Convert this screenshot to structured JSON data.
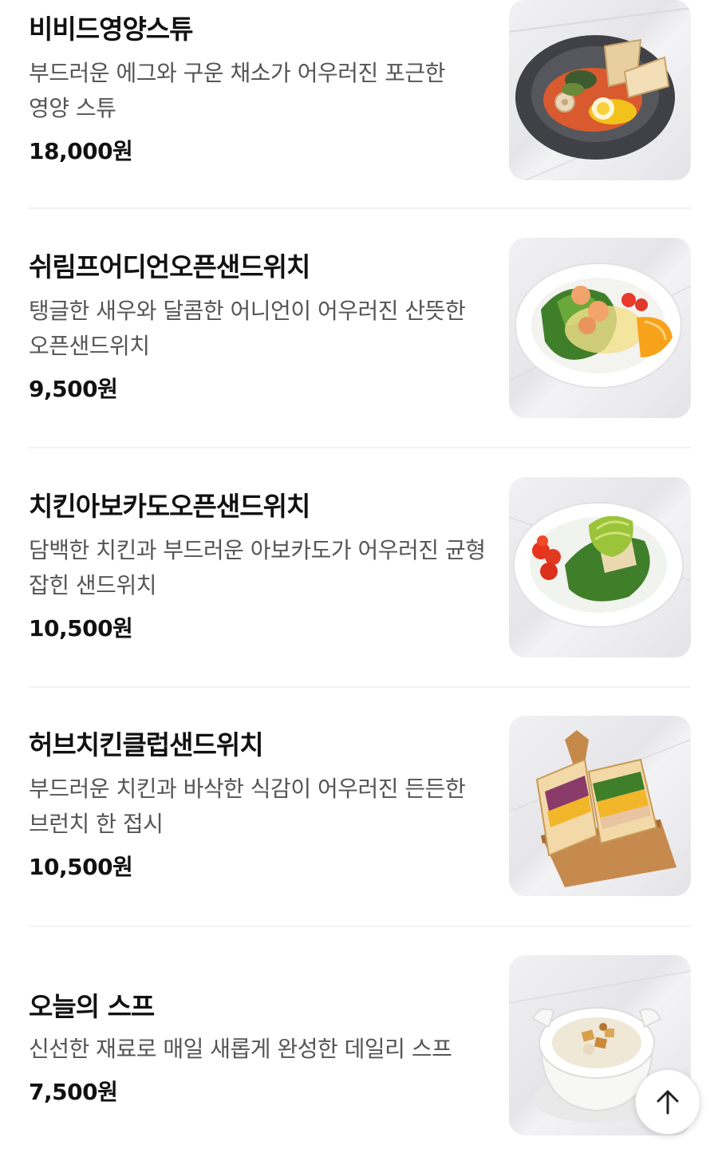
{
  "menu": {
    "items": [
      {
        "name": "비비드영양스튜",
        "description": "부드러운 에그와 구운 채소가 어우러진 포근한 영양 스튜",
        "price": "18,000원",
        "image": "stew-bowl-image"
      },
      {
        "name": "쉬림프어디언오픈샌드위치",
        "description": "탱글한 새우와 달콤한 어니언이 어우러진 산뜻한 오픈샌드위치",
        "price": "9,500원",
        "image": "shrimp-salad-plate-image"
      },
      {
        "name": "치킨아보카도오픈샌드위치",
        "description": "담백한 치킨과 부드러운 아보카도가 어우러진 균형 잡힌 샌드위치",
        "price": "10,500원",
        "image": "chicken-avocado-plate-image"
      },
      {
        "name": "허브치킨클럽샌드위치",
        "description": "부드러운 치킨과 바삭한 식감이 어우러진 든든한 브런치 한 접시",
        "price": "10,500원",
        "image": "club-sandwich-board-image"
      },
      {
        "name": "오늘의 스프",
        "description": "신선한 재료로 매일 새롭게 완성한 데일리 스프",
        "price": "7,500원",
        "image": "soup-pot-image"
      }
    ]
  },
  "scroll_top_button": {
    "icon": "arrow-up-icon"
  },
  "colors": {
    "title": "#111111",
    "description": "#555555",
    "divider": "#f2f2f2",
    "background": "#ffffff"
  }
}
